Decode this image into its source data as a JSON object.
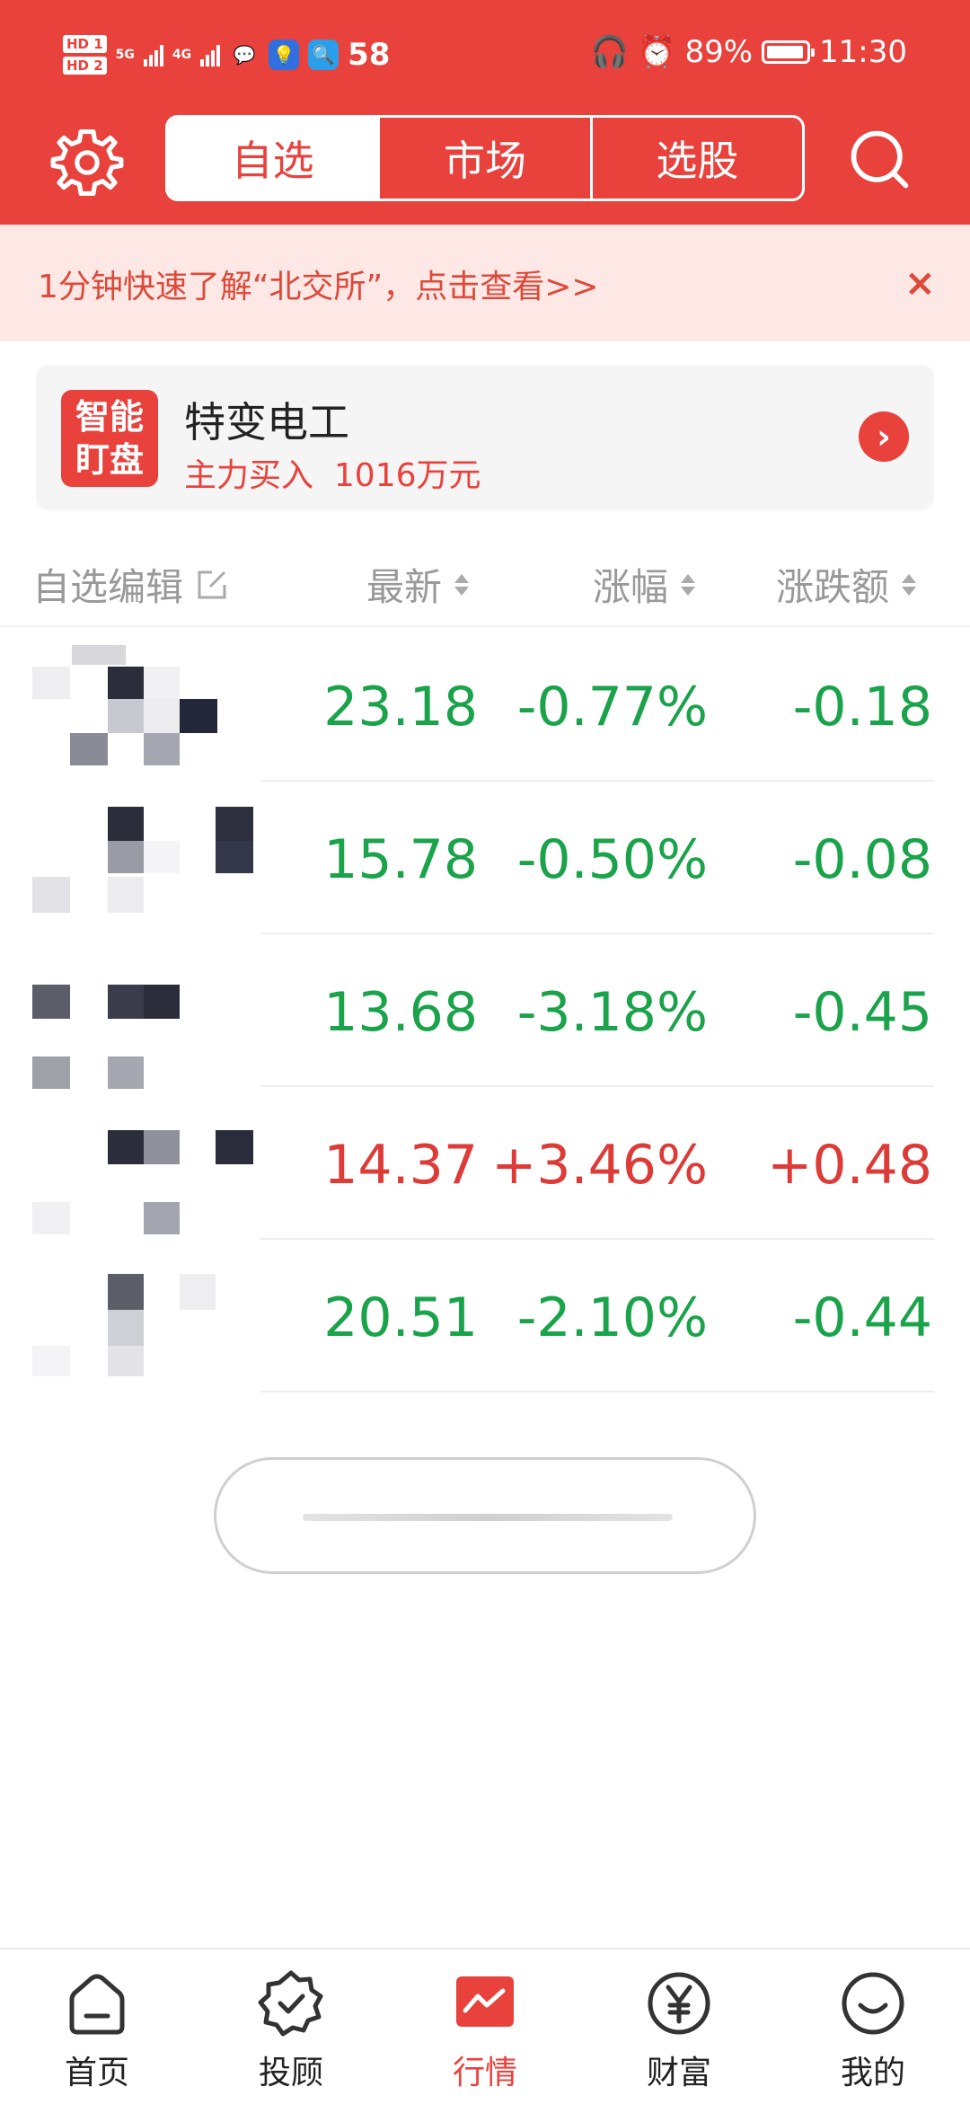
{
  "status_bar": {
    "hd1": "HD 1",
    "hd2": "HD 2",
    "sig1": "5G",
    "sig2": "4G",
    "count": "58",
    "battery": "89%",
    "time": "11:30"
  },
  "header": {
    "tabs": [
      "自选",
      "市场",
      "选股"
    ],
    "active_tab": "自选",
    "accent": "#e9413c"
  },
  "notice": {
    "text": "1分钟快速了解“北交所”，点击查看>>",
    "close": "×"
  },
  "smart_card": {
    "badge": [
      "智能",
      "盯盘"
    ],
    "stock": "特变电工",
    "detail_label": "主力买入",
    "detail_value": "1016万元"
  },
  "table": {
    "edit_label": "自选编辑",
    "columns": [
      "最新",
      "涨幅",
      "涨跌额"
    ],
    "rows": [
      {
        "price": "23.18",
        "pct": "-0.77%",
        "change": "-0.18",
        "trend": "down"
      },
      {
        "price": "15.78",
        "pct": "-0.50%",
        "change": "-0.08",
        "trend": "down"
      },
      {
        "price": "13.68",
        "pct": "-3.18%",
        "change": "-0.45",
        "trend": "down"
      },
      {
        "price": "14.37",
        "pct": "+3.46%",
        "change": "+0.48",
        "trend": "up"
      },
      {
        "price": "20.51",
        "pct": "-2.10%",
        "change": "-0.44",
        "trend": "down"
      }
    ],
    "colors": {
      "up": "#dd3b37",
      "down": "#1aa34a"
    }
  },
  "bottom_nav": {
    "items": [
      "首页",
      "投顾",
      "行情",
      "财富",
      "我的"
    ],
    "active": "行情"
  }
}
